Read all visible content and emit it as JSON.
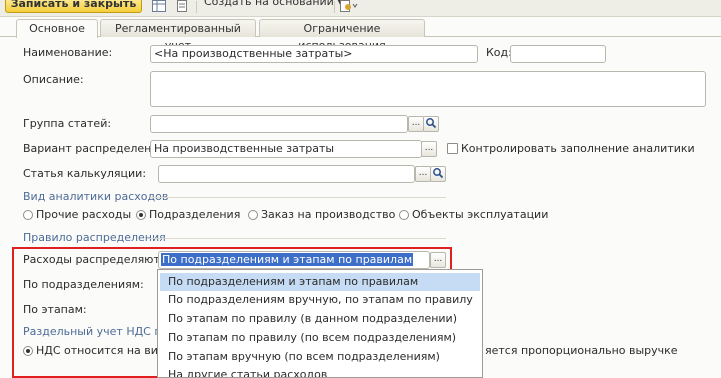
{
  "toolbar": {
    "save_close": "Записать и закрыть",
    "create_based": "Создать на основании",
    "create_arrow": "▾"
  },
  "tabs": [
    {
      "label": "Основное"
    },
    {
      "label": "Регламентированный учет"
    },
    {
      "label": "Ограничение использования"
    }
  ],
  "form": {
    "name_label": "Наименование:",
    "name_value": "<На производственные затраты>",
    "code_label": "Код:",
    "code_value": "",
    "description_label": "Описание:",
    "description_value": "",
    "group_label": "Группа статей:",
    "group_value": "",
    "variant_label": "Вариант распределения:",
    "variant_value": "На производственные затраты",
    "control_label": "Контролировать заполнение аналитики",
    "calc_label": "Статья калькуляции:",
    "calc_value": "",
    "analytics_section": "Вид аналитики расходов",
    "analytics_options": [
      {
        "label": "Прочие расходы",
        "selected": false
      },
      {
        "label": "Подразделения",
        "selected": true
      },
      {
        "label": "Заказ на производство",
        "selected": false
      },
      {
        "label": "Объекты эксплуатации",
        "selected": false
      }
    ],
    "rule_section": "Правило распределения",
    "distributed_label": "Расходы распределяются:",
    "distributed_value": "По подразделениям и этапам по правилам",
    "by_dept_label": "По подразделениям:",
    "by_stage_label": "По этапам:",
    "vat_section": "Раздельный учет НДС по р",
    "vat_option": "НДС относится на вид",
    "vat_option_tail": "яется пропорционально выручке"
  },
  "dropdown": {
    "items": [
      {
        "label": "По подразделениям и этапам по правилам",
        "selected": true
      },
      {
        "label": "По подразделениям вручную, по этапам по правилу",
        "selected": false
      },
      {
        "label": "По этапам по правилу (в данном подразделении)",
        "selected": false
      },
      {
        "label": "По этапам по правилу (по всем подразделениям)",
        "selected": false
      },
      {
        "label": "По этапам вручную (по всем подразделениям)",
        "selected": false
      },
      {
        "label": "На другие статьи расходов",
        "selected": false
      }
    ]
  },
  "colors": {
    "highlight": "#e02020",
    "selection": "#3d6ec8",
    "save_button": "#f4cf3a"
  },
  "icons": [
    "table-icon",
    "list-icon",
    "report-icon",
    "ellipsis-icon",
    "search-icon"
  ]
}
